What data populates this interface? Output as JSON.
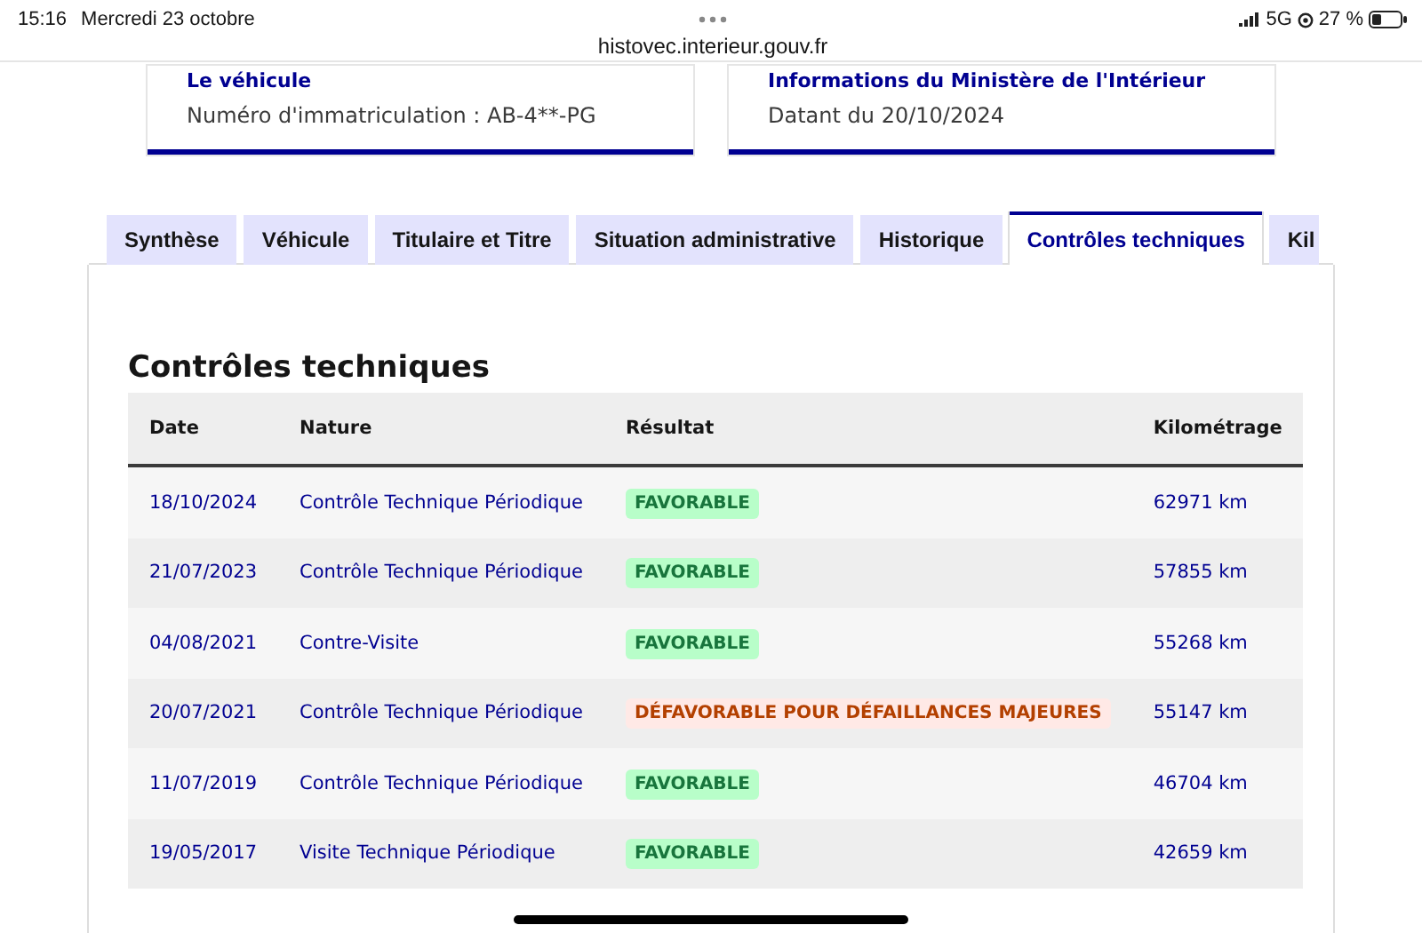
{
  "status_bar": {
    "time": "15:16",
    "date": "Mercredi 23 octobre",
    "network": "5G",
    "battery": "27 %",
    "url": "histovec.interieur.gouv.fr"
  },
  "cards": [
    {
      "title": "Le véhicule",
      "text": "Numéro d'immatriculation : AB-4**-PG"
    },
    {
      "title": "Informations du Ministère de l'Intérieur",
      "text": "Datant du 20/10/2024"
    }
  ],
  "tabs": [
    {
      "label": "Synthèse",
      "selected": false
    },
    {
      "label": "Véhicule",
      "selected": false
    },
    {
      "label": "Titulaire et Titre",
      "selected": false
    },
    {
      "label": "Situation administrative",
      "selected": false
    },
    {
      "label": "Historique",
      "selected": false
    },
    {
      "label": "Contrôles techniques",
      "selected": true
    },
    {
      "label": "Kil",
      "selected": false
    }
  ],
  "section_title": "Contrôles techniques",
  "table": {
    "columns": [
      "Date",
      "Nature",
      "Résultat",
      "Kilométrage"
    ],
    "rows": [
      {
        "date": "18/10/2024",
        "nature": "Contrôle Technique Périodique",
        "result": "FAVORABLE",
        "kind": "favorable",
        "km": "62971 km"
      },
      {
        "date": "21/07/2023",
        "nature": "Contrôle Technique Périodique",
        "result": "FAVORABLE",
        "kind": "favorable",
        "km": "57855 km"
      },
      {
        "date": "04/08/2021",
        "nature": "Contre-Visite",
        "result": "FAVORABLE",
        "kind": "favorable",
        "km": "55268 km"
      },
      {
        "date": "20/07/2021",
        "nature": "Contrôle Technique Périodique",
        "result": "DÉFAVORABLE POUR DÉFAILLANCES MAJEURES",
        "kind": "defavorable",
        "km": "55147 km"
      },
      {
        "date": "11/07/2019",
        "nature": "Contrôle Technique Périodique",
        "result": "FAVORABLE",
        "kind": "favorable",
        "km": "46704 km"
      },
      {
        "date": "19/05/2017",
        "nature": "Visite Technique Périodique",
        "result": "FAVORABLE",
        "kind": "favorable",
        "km": "42659 km"
      }
    ]
  }
}
